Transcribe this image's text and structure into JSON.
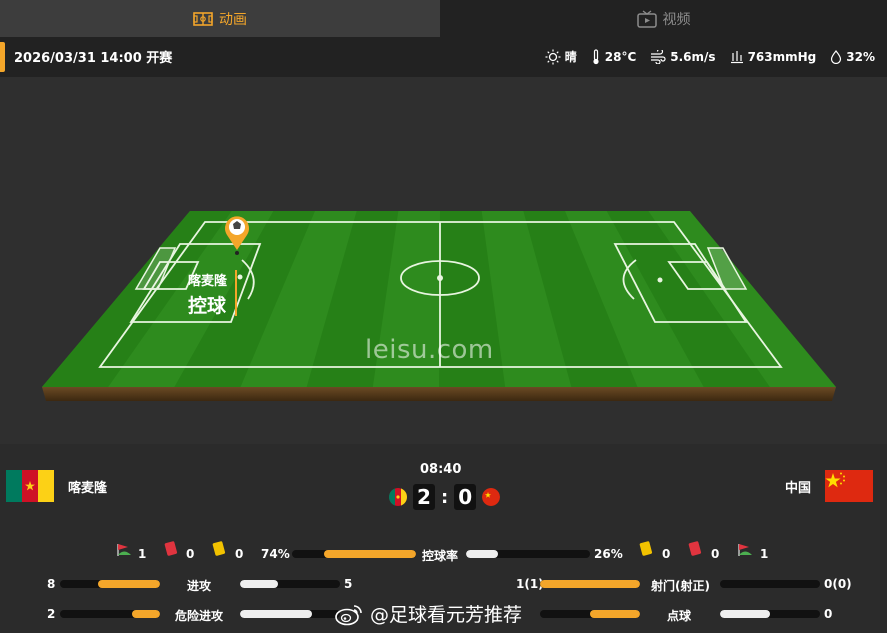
{
  "tabs": [
    {
      "label": "动画",
      "icon": "animation-icon",
      "active": true
    },
    {
      "label": "视频",
      "icon": "video-icon",
      "active": false
    }
  ],
  "info": {
    "kickoff": "2026/03/31 14:00 开赛",
    "weather": [
      {
        "icon": "sun-icon",
        "text": "晴"
      },
      {
        "icon": "thermometer-icon",
        "text": "28°C"
      },
      {
        "icon": "wind-icon",
        "text": "5.6m/s"
      },
      {
        "icon": "pressure-icon",
        "text": "763mmHg"
      },
      {
        "icon": "humidity-icon",
        "text": "32%"
      }
    ]
  },
  "pitch": {
    "watermark": "leisu.com",
    "event_team": "喀麦隆",
    "event_action": "控球"
  },
  "match": {
    "home": {
      "name": "喀麦隆",
      "flag": "cameroon-flag",
      "colors": [
        "#007a5e",
        "#ce1126",
        "#fcd116"
      ]
    },
    "away": {
      "name": "中国",
      "flag": "china-flag",
      "colors": [
        "#de2910",
        "#ffde00"
      ]
    },
    "clock": "08:40",
    "home_score": "2",
    "away_score": "0"
  },
  "stats": {
    "home_corners": "1",
    "home_red": "0",
    "home_yellow": "0",
    "possession_label": "控球率",
    "home_possession": "74%",
    "away_possession": "26%",
    "home_possession_value": 0.74,
    "away_possession_value": 0.26,
    "away_yellow": "0",
    "away_red": "0",
    "away_corners": "1",
    "attack_label": "进攻",
    "home_attack": "8",
    "away_attack": "5",
    "danger_label": "危险进攻",
    "home_danger": "2",
    "away_danger": "",
    "shots_label": "射门(射正)",
    "home_shots": "1(1)",
    "away_shots": "0(0)",
    "penalty_label": "点球",
    "away_penalty": "0"
  },
  "overlay": {
    "weibo_text": "@足球看元芳推荐"
  },
  "colors": {
    "accent": "#f4a62a",
    "pitch_green": "#2e8b1e",
    "yellow_card": "#f2c200",
    "red_card": "#e0343f"
  }
}
